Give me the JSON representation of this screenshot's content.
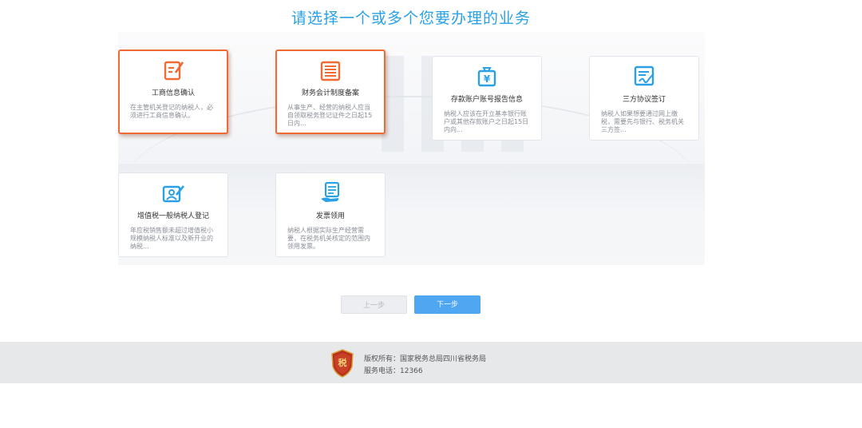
{
  "page": {
    "title": "请选择一个或多个您要办理的业务"
  },
  "cards": [
    {
      "title": "工商信息确认",
      "desc": "在主管机关登记的纳税人，必须进行工商信息确认。",
      "icon": "edit-form-icon",
      "selected": true
    },
    {
      "title": "财务会计制度备案",
      "desc": "从事生产、经营的纳税人应当自领取税务登记证件之日起15日内...",
      "icon": "document-list-icon",
      "selected": true
    },
    {
      "title": "存款账户账号报告信息",
      "desc": "纳税人应该在开立基本银行账户或其他存款账户之日起15日内向...",
      "icon": "yuan-bag-icon",
      "selected": false
    },
    {
      "title": "三方协议签订",
      "desc": "纳税人如果想要通过网上缴税，需要先与银行、税务机关三方签...",
      "icon": "signature-doc-icon",
      "selected": false
    },
    {
      "title": "增值税一般纳税人登记",
      "desc": "年应税销售额未超过增值税小规模纳税人标准以及新开业的纳税...",
      "icon": "person-card-icon",
      "selected": false
    },
    {
      "title": "发票领用",
      "desc": "纳税人根据实际生产经营需要，在税务机关核定的范围内领用发票。",
      "icon": "invoice-hand-icon",
      "selected": false
    }
  ],
  "buttons": {
    "prev": "上一步",
    "next": "下一步"
  },
  "footer": {
    "emblem_text": "税",
    "copyright": "版权所有：国家税务总局四川省税务局",
    "phone": "服务电话：12366"
  },
  "colors": {
    "accent_blue": "#2aa1e6",
    "selected_orange": "#f06a33",
    "next_button": "#4ea7f0"
  }
}
